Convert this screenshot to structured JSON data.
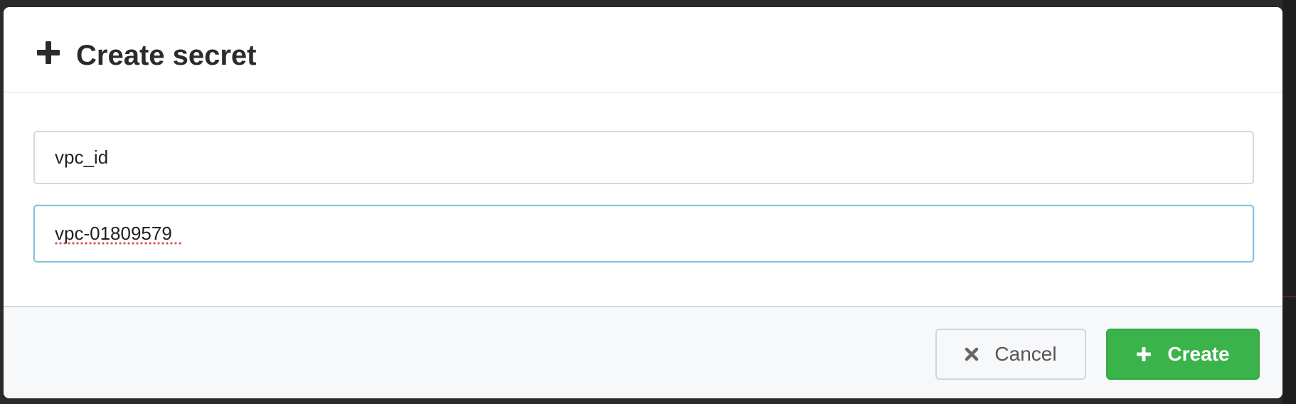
{
  "modal": {
    "title": "Create secret",
    "title_icon": "plus-icon"
  },
  "form": {
    "key_value": "vpc_id",
    "secret_value": "vpc-01809579"
  },
  "footer": {
    "cancel_label": "Cancel",
    "cancel_icon": "times-icon",
    "create_label": "Create",
    "create_icon": "plus-icon"
  },
  "colors": {
    "create_button": "#3ab34a",
    "focused_border": "#8cc3dc",
    "footer_background": "#f7f8fa"
  }
}
